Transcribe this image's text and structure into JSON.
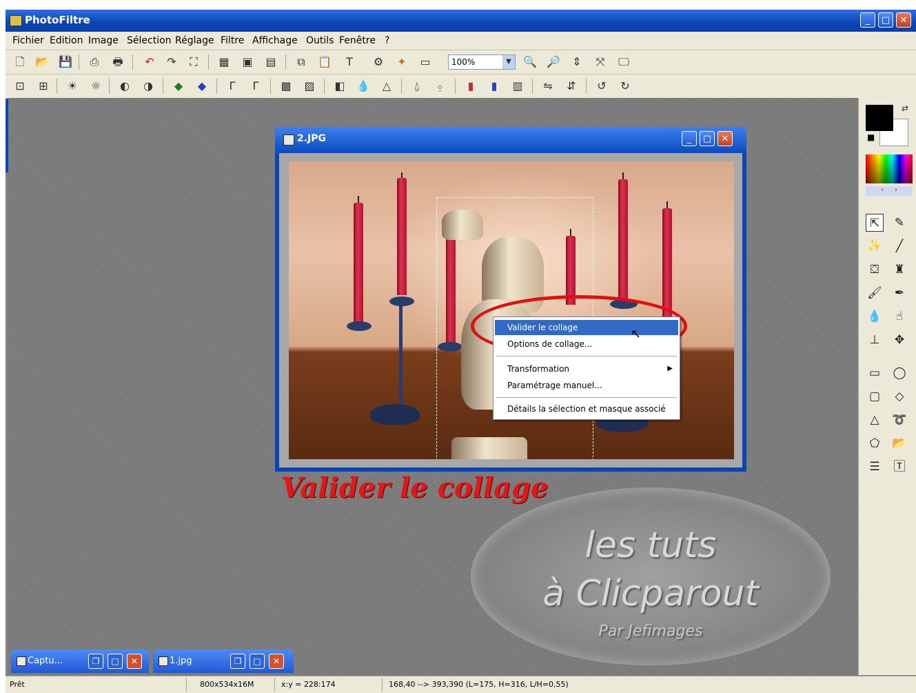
{
  "app": {
    "title": "PhotoFiltre"
  },
  "menu": [
    "Fichier",
    "Edition",
    "Image",
    "Sélection",
    "Réglage",
    "Filtre",
    "Affichage",
    "Outils",
    "Fenêtre",
    "?"
  ],
  "toolbar": {
    "zoom_value": "100%"
  },
  "document": {
    "title": "2.JPG"
  },
  "context_menu": {
    "items": [
      {
        "label": "Valider le collage",
        "highlighted": true
      },
      {
        "label": "Options de collage..."
      },
      {
        "label": "Transformation",
        "submenu": true
      },
      {
        "label": "Paramétrage manuel..."
      },
      {
        "label": "Détails la sélection et masque associé"
      }
    ]
  },
  "caption": "Valider le collage",
  "watermark": {
    "line1": "les tuts",
    "line2": "à Clicparout",
    "line3": "Par Jefimages"
  },
  "taskbar": [
    {
      "label": "Captu..."
    },
    {
      "label": "1.jpg"
    }
  ],
  "status": {
    "state": "Prêt",
    "image_size": "800x534x16M",
    "coords": "x:y = 228:174",
    "selection": "168,40 --> 393,390 (L=175, H=316, L/H=0,55)"
  },
  "colors": {
    "accent": "#0b44b5",
    "caption_red": "#e01818",
    "highlight": "#316ac5"
  }
}
